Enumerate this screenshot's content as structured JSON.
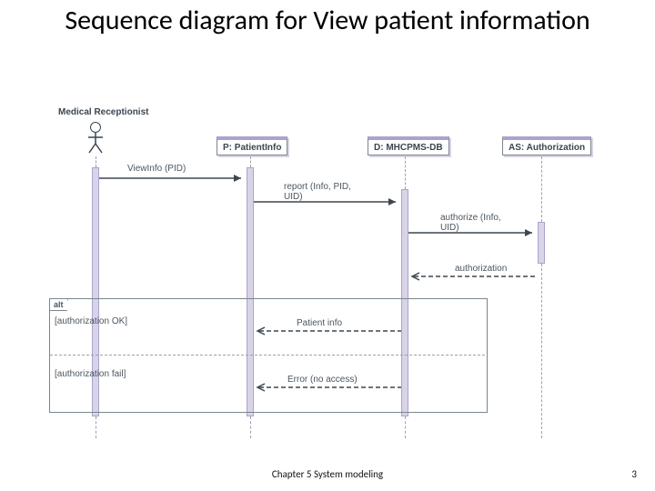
{
  "title": "Sequence diagram for View patient information",
  "footer": "Chapter 5 System modeling",
  "page_number": "3",
  "diagram": {
    "actor_label": "Medical Receptionist",
    "lifelines": {
      "p": "P: PatientInfo",
      "d": "D: MHCPMS-DB",
      "as": "AS: Authorization"
    },
    "messages": {
      "m1": "ViewInfo (PID)",
      "m2_line1": "report (Info, PID,",
      "m2_line2": "UID)",
      "m3_line1": "authorize (Info,",
      "m3_line2": "UID)",
      "m4": "authorization",
      "m5": "Patient info",
      "m6": "Error (no access)"
    },
    "alt": {
      "label": "alt",
      "guard_ok": "[authorization OK]",
      "guard_fail": "[authorization fail]"
    }
  },
  "chart_data": {
    "type": "sequence",
    "actors": [
      {
        "id": "MR",
        "name": "Medical Receptionist",
        "kind": "actor"
      },
      {
        "id": "P",
        "name": "P: PatientInfo",
        "kind": "object"
      },
      {
        "id": "D",
        "name": "D: MHCPMS-DB",
        "kind": "object"
      },
      {
        "id": "AS",
        "name": "AS: Authorization",
        "kind": "object"
      }
    ],
    "messages": [
      {
        "from": "MR",
        "to": "P",
        "label": "ViewInfo (PID)",
        "type": "call"
      },
      {
        "from": "P",
        "to": "D",
        "label": "report (Info, PID, UID)",
        "type": "call"
      },
      {
        "from": "D",
        "to": "AS",
        "label": "authorize (Info, UID)",
        "type": "call"
      },
      {
        "from": "AS",
        "to": "D",
        "label": "authorization",
        "type": "return"
      }
    ],
    "fragments": [
      {
        "type": "alt",
        "operands": [
          {
            "guard": "[authorization OK]",
            "messages": [
              {
                "from": "D",
                "to": "P",
                "label": "Patient info",
                "type": "return"
              }
            ]
          },
          {
            "guard": "[authorization fail]",
            "messages": [
              {
                "from": "D",
                "to": "P",
                "label": "Error (no access)",
                "type": "return"
              }
            ]
          }
        ]
      }
    ]
  }
}
